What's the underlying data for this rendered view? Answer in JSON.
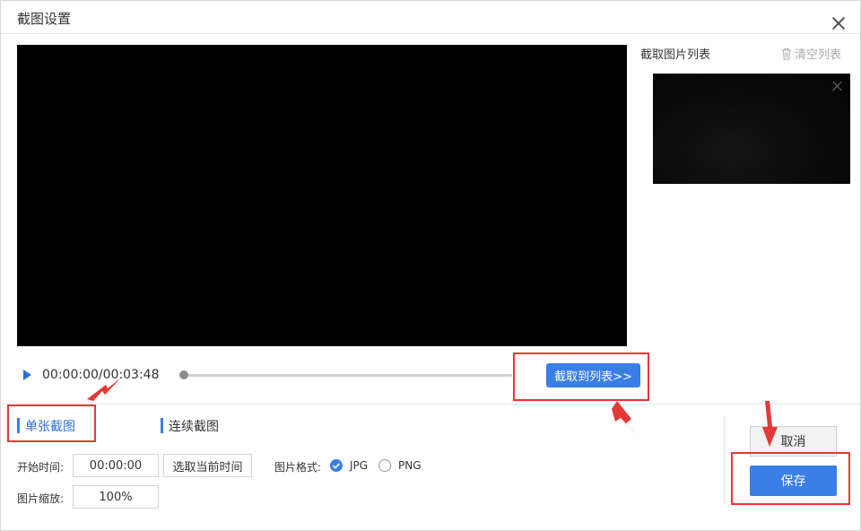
{
  "window": {
    "title": "截图设置"
  },
  "list_panel": {
    "title": "截取图片列表",
    "clear_label": "清空列表"
  },
  "player": {
    "time": "00:00:00/00:03:48",
    "progress": 0.0,
    "capture_label": "截取到列表>>"
  },
  "tabs": [
    {
      "label": "单张截图",
      "active": true
    },
    {
      "label": "连续截图",
      "active": false
    }
  ],
  "settings": {
    "start_time_label": "开始时间:",
    "start_time_value": "00:00:00",
    "pick_current_label": "选取当前时间",
    "format_label": "图片格式:",
    "formats": [
      {
        "label": "JPG",
        "selected": true
      },
      {
        "label": "PNG",
        "selected": false
      }
    ],
    "scale_label": "图片缩放:",
    "scale_value": "100%"
  },
  "actions": {
    "cancel_label": "取消",
    "save_label": "保存"
  },
  "colors": {
    "accent": "#3a7ee8",
    "annotation": "#e53935"
  }
}
